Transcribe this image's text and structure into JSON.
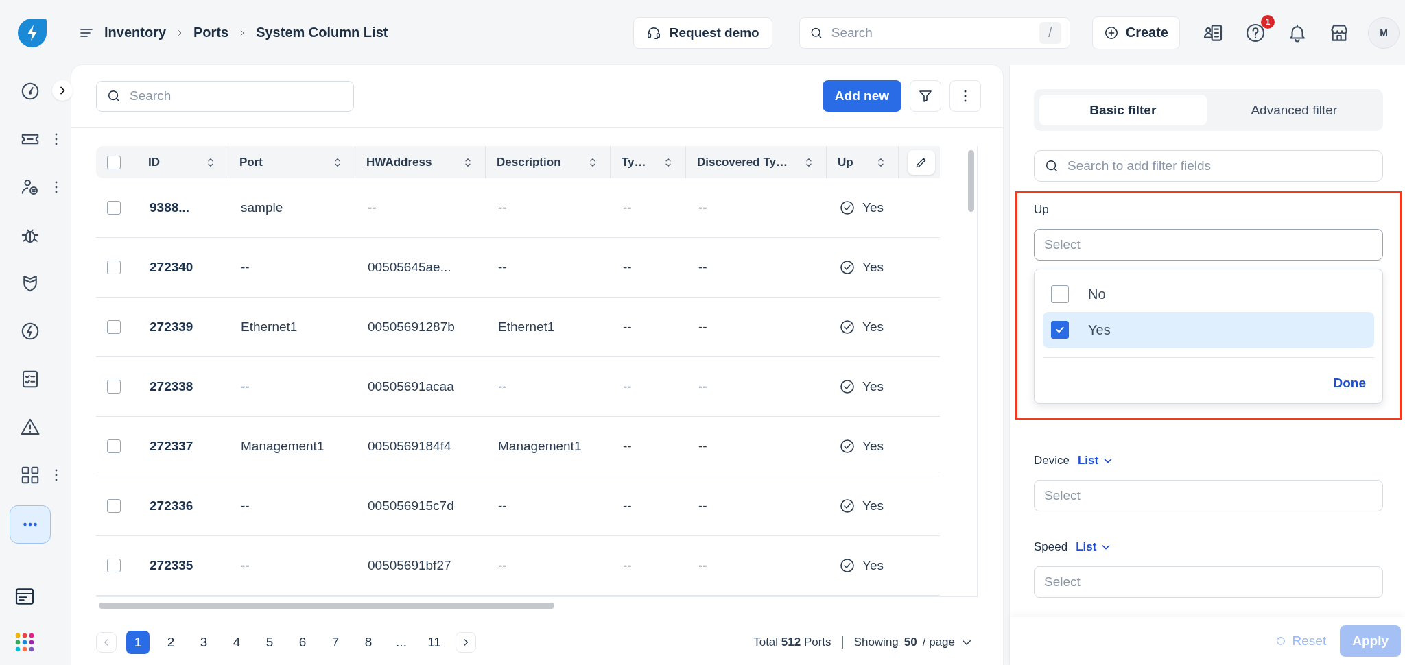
{
  "breadcrumb": [
    "Inventory",
    "Ports",
    "System Column List"
  ],
  "topbar": {
    "demo_button": "Request demo",
    "search": {
      "placeholder": "Search",
      "shortcut": "/"
    },
    "create_button": "Create",
    "help_badge": "1",
    "avatar": "M"
  },
  "sidebar": {
    "items": [
      {
        "selected": false
      },
      {
        "selected": false,
        "menu": true
      },
      {
        "selected": false,
        "menu": true
      },
      {
        "selected": false,
        "menu": false
      },
      {
        "selected": false,
        "menu": false
      },
      {
        "selected": false,
        "menu": false
      },
      {
        "selected": false,
        "menu": false
      },
      {
        "selected": false,
        "menu": false
      },
      {
        "selected": false,
        "menu": true
      },
      {
        "selected": true,
        "menu": false
      }
    ]
  },
  "list": {
    "search": {
      "placeholder": "Search"
    },
    "add_button": "Add new",
    "table": {
      "all_checked": false,
      "columns": [
        {
          "label": "ID",
          "kind": "id"
        },
        {
          "label": "Port",
          "kind": "text"
        },
        {
          "label": "HWAddress",
          "kind": "text"
        },
        {
          "label": "Description",
          "kind": "text"
        },
        {
          "label": "Ty…",
          "kind": "text"
        },
        {
          "label": "Discovered Ty…",
          "kind": "text"
        },
        {
          "label": "Up",
          "kind": "status"
        }
      ],
      "rows": [
        {
          "checked": false,
          "cells": [
            "9388...",
            "sample",
            "--",
            "--",
            "--",
            "--",
            "Yes"
          ]
        },
        {
          "checked": false,
          "cells": [
            "272340",
            "--",
            "00505645ae...",
            "--",
            "--",
            "--",
            "Yes"
          ]
        },
        {
          "checked": false,
          "cells": [
            "272339",
            "Ethernet1",
            "00505691287b",
            "Ethernet1",
            "--",
            "--",
            "Yes"
          ]
        },
        {
          "checked": false,
          "cells": [
            "272338",
            "--",
            "00505691acaa",
            "--",
            "--",
            "--",
            "Yes"
          ]
        },
        {
          "checked": false,
          "cells": [
            "272337",
            "Management1",
            "0050569184f4",
            "Management1",
            "--",
            "--",
            "Yes"
          ]
        },
        {
          "checked": false,
          "cells": [
            "272336",
            "--",
            "005056915c7d",
            "--",
            "--",
            "--",
            "Yes"
          ]
        },
        {
          "checked": false,
          "cells": [
            "272335",
            "--",
            "00505691bf27",
            "--",
            "--",
            "--",
            "Yes"
          ]
        }
      ]
    },
    "pagination": {
      "pages": [
        {
          "label": "1",
          "selected": true
        },
        {
          "label": "2",
          "selected": false
        },
        {
          "label": "3",
          "selected": false
        },
        {
          "label": "4",
          "selected": false
        },
        {
          "label": "5",
          "selected": false
        },
        {
          "label": "6",
          "selected": false
        },
        {
          "label": "7",
          "selected": false
        },
        {
          "label": "8",
          "selected": false
        },
        {
          "label": "...",
          "selected": false
        },
        {
          "label": "11",
          "selected": false
        }
      ],
      "total": "Total **512** Ports",
      "page_size": "Showing **50** / page"
    }
  },
  "filter_panel": {
    "tabs": [
      {
        "label": "Basic filter",
        "selected": true
      },
      {
        "label": "Advanced filter",
        "selected": false
      }
    ],
    "search": {
      "placeholder": "Search to add filter fields"
    },
    "fields": [
      {
        "label": "Up",
        "placeholder": "Select",
        "open": true,
        "options": [
          {
            "label": "No",
            "checked": false
          },
          {
            "label": "Yes",
            "checked": true
          }
        ],
        "done": "Done"
      },
      {
        "label": "Device",
        "mode": "List",
        "placeholder": "Select",
        "open": false
      },
      {
        "label": "Speed",
        "mode": "List",
        "placeholder": "Select",
        "open": false
      }
    ],
    "reset_button": {
      "label": "Reset",
      "disabled": true
    },
    "apply_button": {
      "label": "Apply",
      "disabled": true
    }
  }
}
